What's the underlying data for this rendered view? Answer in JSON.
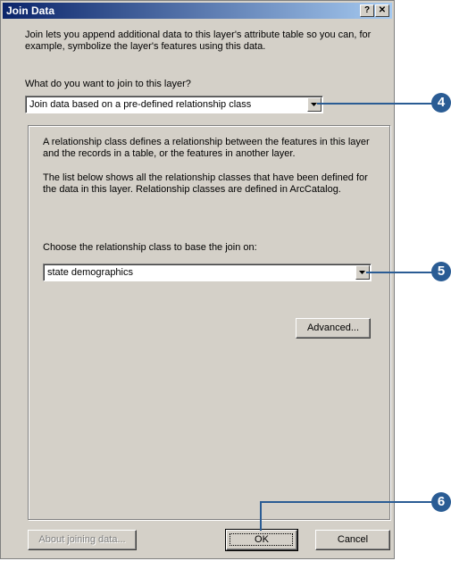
{
  "window": {
    "title": "Join Data",
    "help_glyph": "?",
    "close_glyph": "✕"
  },
  "intro": {
    "text": "Join lets you append additional data to this layer's attribute table so you can, for example, symbolize the layer's features using this data."
  },
  "join_type": {
    "question": "What do you want to join to this layer?",
    "selected": "Join data based on a pre-defined relationship class"
  },
  "group": {
    "paragraph1": "A relationship class defines a relationship between the features in this layer and the records in a table, or the features in another layer.",
    "paragraph2": "The list below shows all the relationship classes that have been defined for the data in this layer. Relationship classes are defined in ArcCatalog.",
    "choose_label": "Choose the relationship class to base the join on:",
    "selected_class": "state demographics",
    "advanced_label": "Advanced..."
  },
  "buttons": {
    "about": "About joining data...",
    "ok": "OK",
    "cancel": "Cancel"
  },
  "callouts": {
    "step4": "4",
    "step5": "5",
    "step6": "6",
    "color": "#2a5c94"
  }
}
